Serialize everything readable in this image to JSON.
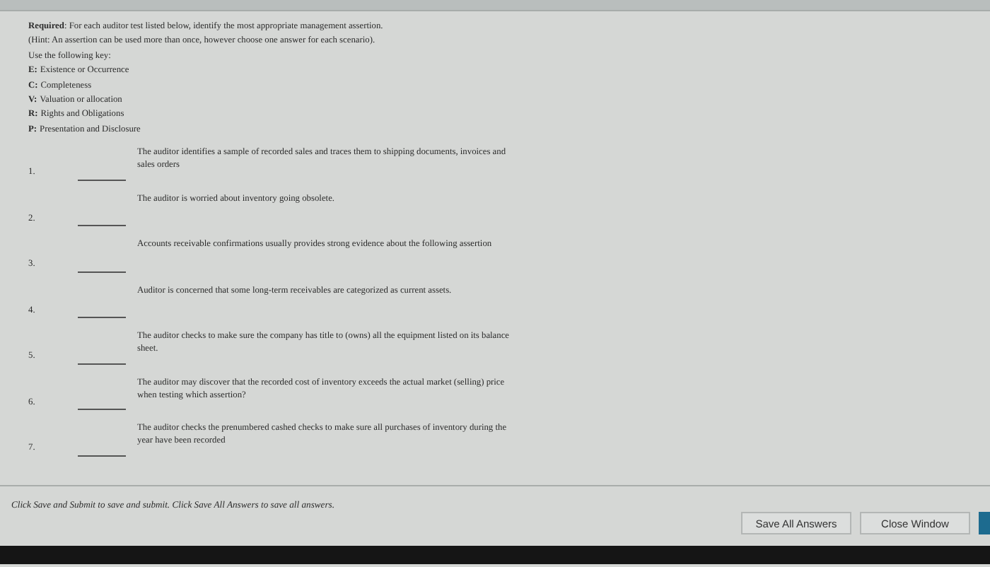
{
  "instructions": {
    "required": "**Required**: For each auditor test listed below, identify the most appropriate management assertion.",
    "hint": "(Hint: An assertion can be used more than once, however choose one answer for each scenario).",
    "key_intro": "Use the following key:",
    "key": [
      {
        "letter": "E:",
        "meaning": "Existence or Occurrence"
      },
      {
        "letter": "C:",
        "meaning": "Completeness"
      },
      {
        "letter": "V:",
        "meaning": "Valuation or allocation"
      },
      {
        "letter": "R:",
        "meaning": "Rights and Obligations"
      },
      {
        "letter": "P:",
        "meaning": "Presentation and Disclosure"
      }
    ]
  },
  "questions": [
    {
      "number": "1.",
      "text": "The auditor identifies a sample of recorded sales and traces them to shipping documents, invoices and sales orders"
    },
    {
      "number": "2.",
      "text": "The auditor is worried about inventory going obsolete."
    },
    {
      "number": "3.",
      "text": "Accounts receivable confirmations usually provides strong evidence about the following assertion"
    },
    {
      "number": "4.",
      "text": "Auditor is concerned that some long-term receivables are categorized as current assets."
    },
    {
      "number": "5.",
      "text": "The auditor checks to make sure the company has title to (owns) all the equipment listed on its balance sheet."
    },
    {
      "number": "6.",
      "text": "The auditor may discover that the recorded cost of inventory exceeds the actual market (selling) price when testing which assertion?"
    },
    {
      "number": "7.",
      "text": "The auditor checks the prenumbered cashed checks to make sure all purchases of inventory during the year have been recorded"
    }
  ],
  "footer": {
    "note": "Click Save and Submit to save and submit. Click Save All Answers to save all answers.",
    "buttons": [
      {
        "label": "Save All Answers",
        "kind": "plain"
      },
      {
        "label": "Close Window",
        "kind": "plain"
      },
      {
        "kind": "primary"
      }
    ]
  }
}
